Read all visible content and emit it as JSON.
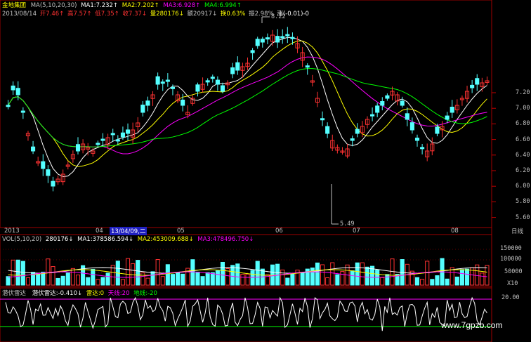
{
  "stock": {
    "name": "金地集团",
    "ma_header": "MA(5,10,20,30)"
  },
  "ma": [
    {
      "label": "MA1:7.232↑",
      "color": "#ffffff"
    },
    {
      "label": "MA2:7.202↑",
      "color": "#ffff00"
    },
    {
      "label": "MA3:6.928↑",
      "color": "#ff00ff"
    },
    {
      "label": "MA4:6.994↑",
      "color": "#00ff00"
    }
  ],
  "quote": {
    "date": "2013/08/14",
    "open": "开7.46↑",
    "high": "高7.57↑",
    "low": "低7.35↑",
    "close": "收7.37↓",
    "volume": "量280176↓",
    "amount": "额20917↓",
    "turnover": "换0.63%",
    "amplitude": "振2.98%",
    "change": "涨(-0.01)-0"
  },
  "price_axis": [
    "7.20",
    "7.00",
    "6.80",
    "6.60",
    "6.40",
    "6.20",
    "6.00",
    "5.80",
    "5.60"
  ],
  "annotations": {
    "high": "8.22",
    "low": "5.49"
  },
  "time_axis": {
    "labels": [
      "2013",
      "04",
      "13/04/09,二",
      "05",
      "06",
      "07",
      "08"
    ],
    "period": "日线"
  },
  "vol": {
    "header": "VOL(5,10,20)",
    "value": "280176↓",
    "ma1": "MA1:378586.594↓",
    "ma2": "MA2:453009.688↓",
    "ma3": "MA3:478496.750↓",
    "axis": [
      "150000",
      "100000",
      "50000"
    ],
    "unit": "X10"
  },
  "indicator": {
    "name": "潜伏雷达",
    "line1": "潜伏雷达:-0.410↓",
    "line2": "雷达:0",
    "line3": "天线:20",
    "line4": "地线:-20",
    "axis": "20.00"
  },
  "watermark": "www.7gpzb.com",
  "colors": {
    "up": "#ff3232",
    "down": "#54ffff",
    "grid": "#a00000",
    "axis": "#c00000"
  }
}
